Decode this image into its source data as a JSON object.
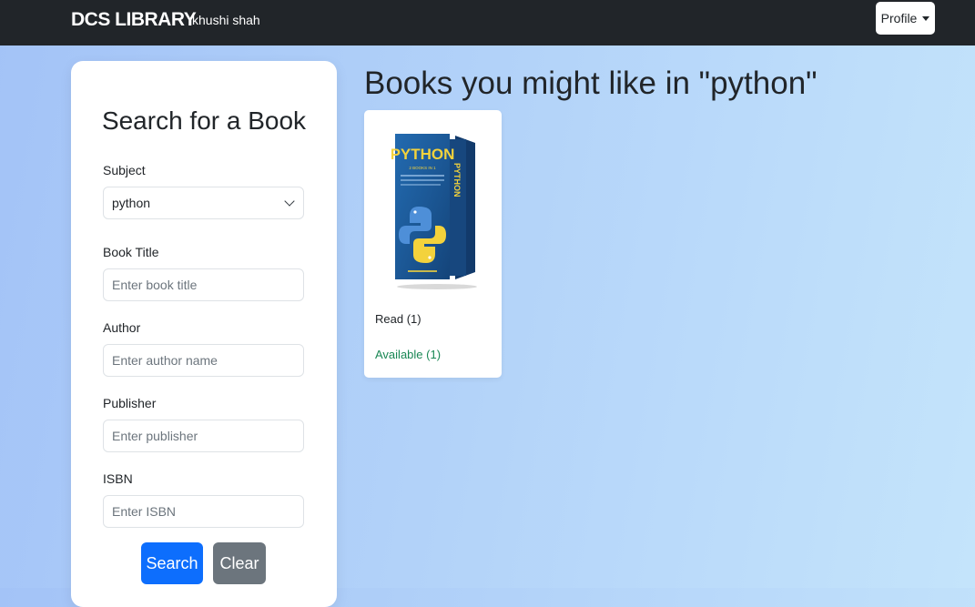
{
  "navbar": {
    "brand": "DCS LIBRARY",
    "username": "khushi shah",
    "profile_label": "Profile"
  },
  "search": {
    "title": "Search for a Book",
    "subject_label": "Subject",
    "subject_value": "python",
    "title_label": "Book Title",
    "title_placeholder": "Enter book title",
    "author_label": "Author",
    "author_placeholder": "Enter author name",
    "publisher_label": "Publisher",
    "publisher_placeholder": "Enter publisher",
    "isbn_label": "ISBN",
    "isbn_placeholder": "Enter ISBN",
    "search_button": "Search",
    "clear_button": "Clear"
  },
  "results": {
    "heading": "Books you might like in \"python\"",
    "books": [
      {
        "cover_title": "PYTHON",
        "cover_subtitle": "2 BOOKS IN 1",
        "read": "Read (1)",
        "available": "Available (1)"
      }
    ]
  },
  "colors": {
    "navbar": "#212529",
    "primary": "#0d6efd",
    "secondary": "#6c757d",
    "success": "#198754"
  }
}
